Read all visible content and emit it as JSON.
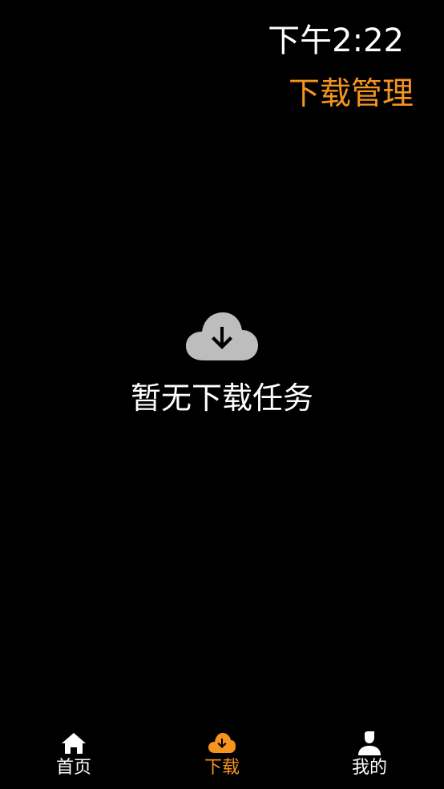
{
  "status_bar": {
    "time": "下午2:22"
  },
  "header": {
    "title": "下载管理"
  },
  "empty_state": {
    "icon": "cloud-download-icon",
    "message": "暂无下载任务"
  },
  "bottom_nav": {
    "items": [
      {
        "label": "首页",
        "icon": "home-icon",
        "active": false
      },
      {
        "label": "下载",
        "icon": "cloud-download-icon",
        "active": true
      },
      {
        "label": "我的",
        "icon": "user-icon",
        "active": false
      }
    ]
  },
  "colors": {
    "background": "#000000",
    "accent": "#f5941e",
    "text": "#ffffff",
    "icon_gray": "#bdbdbd"
  }
}
